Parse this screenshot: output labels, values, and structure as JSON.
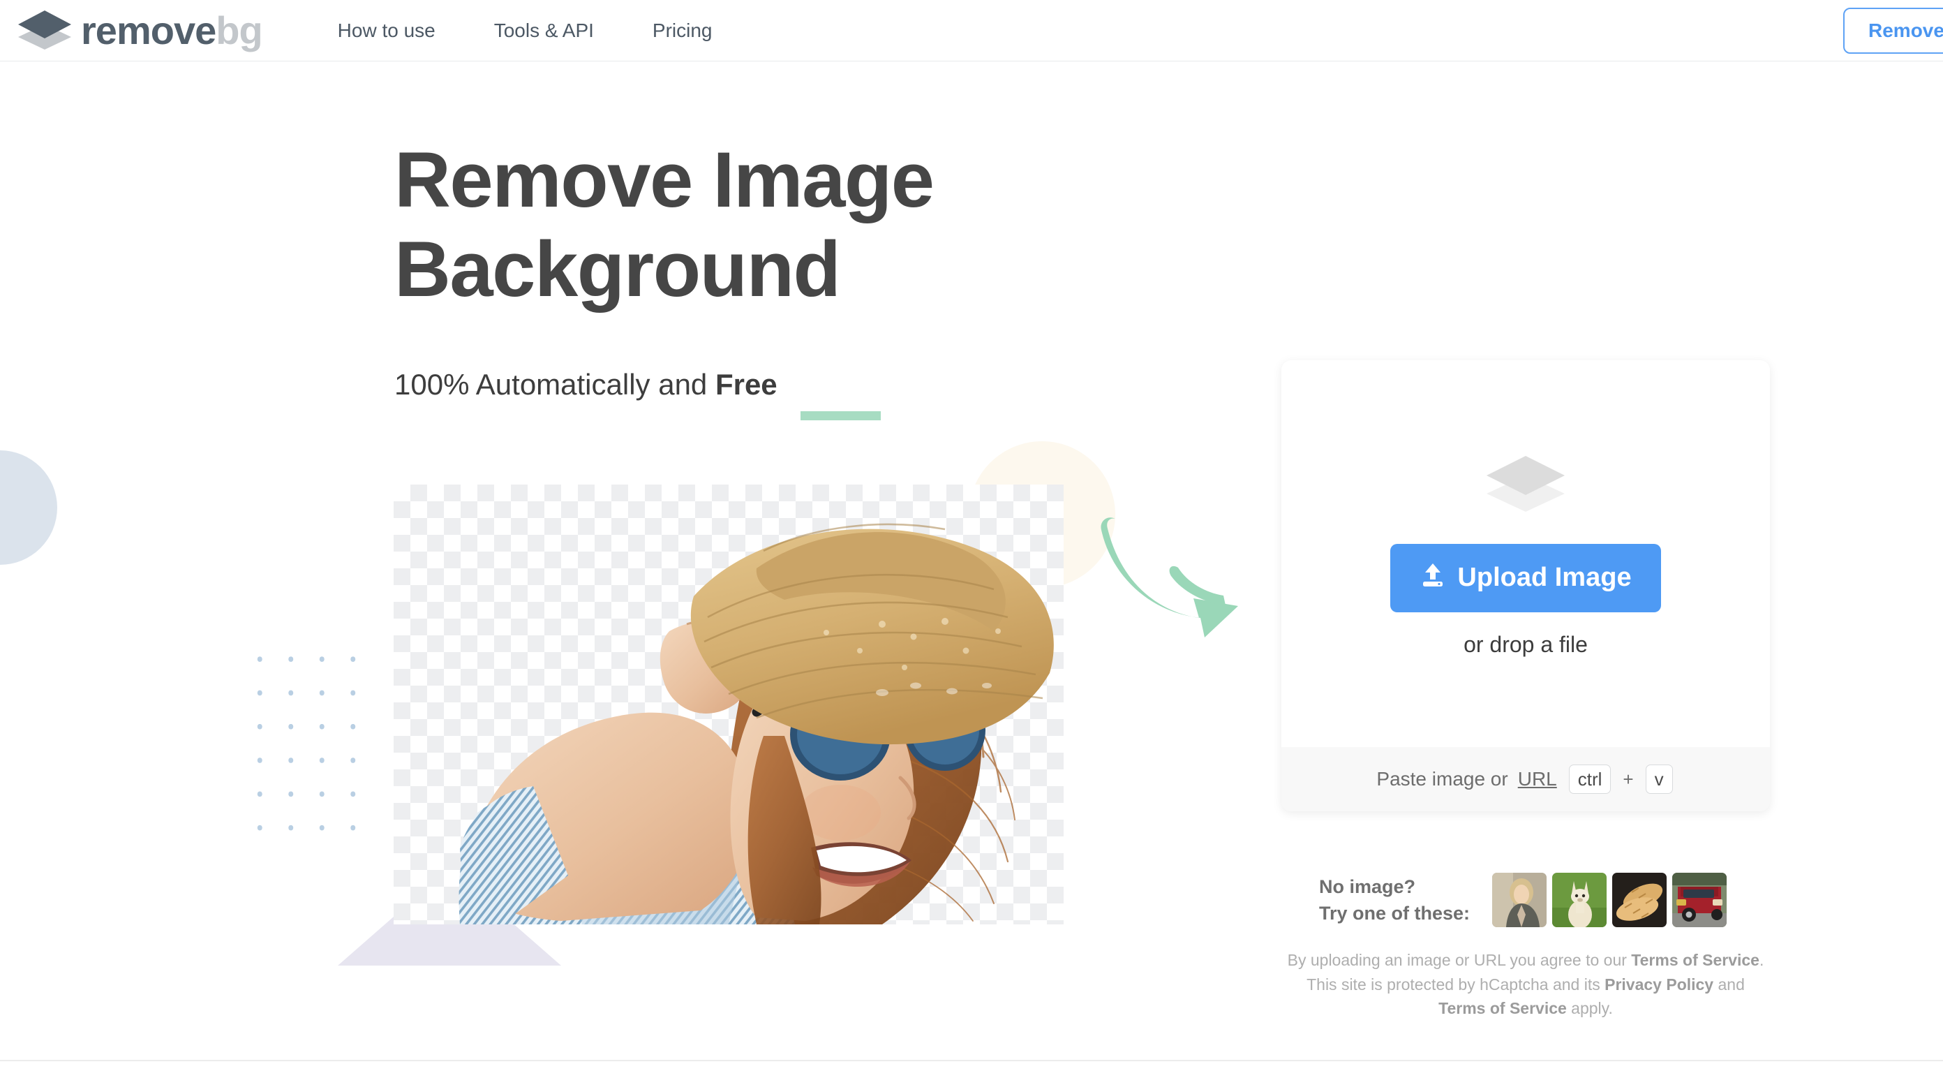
{
  "header": {
    "logo": {
      "icon": "stacked-layers-logo-icon",
      "text_primary": "remove",
      "text_secondary": "bg"
    },
    "nav": [
      {
        "label": "How to use"
      },
      {
        "label": "Tools & API"
      },
      {
        "label": "Pricing"
      }
    ],
    "cta": {
      "label": "Remove Background"
    }
  },
  "hero": {
    "title_line1": "Remove Image",
    "title_line2": "Background",
    "subtitle_prefix": "100% Automatically and ",
    "subtitle_emphasis": "Free",
    "image_alt": "Woman in straw hat and sunglasses with transparent checkerboard background"
  },
  "upload": {
    "stack_icon": "stacked-layers-icon",
    "button_icon": "upload-arrow-icon",
    "button_label": "Upload Image",
    "drop_text": "or drop a file",
    "paste_text": "Paste image or ",
    "paste_link": "URL",
    "key_ctrl": "ctrl",
    "key_plus": "+",
    "key_v": "v"
  },
  "samples": {
    "label_line1": "No image?",
    "label_line2": "Try one of these:",
    "items": [
      {
        "name": "sample-woman",
        "alt": "Blonde woman in grey cardigan"
      },
      {
        "name": "sample-alpaca",
        "alt": "White alpaca on green grass"
      },
      {
        "name": "sample-bread",
        "alt": "Two loaves of bread"
      },
      {
        "name": "sample-car",
        "alt": "Red SUV rear view"
      }
    ]
  },
  "legal": {
    "part1": "By uploading an image or URL you agree to our ",
    "tos1": "Terms of Service",
    "part2": ". This site is protected by hCaptcha and its ",
    "privacy": "Privacy Policy",
    "part3": " and ",
    "tos2": "Terms of Service",
    "part4": " apply."
  },
  "colors": {
    "accent_blue": "#4e9af4",
    "cta_border": "#5ea2f5",
    "logo_dark": "#525f6b",
    "logo_light": "#c3c7cb",
    "arrow_green": "#9ad7b8",
    "underline_green": "#a7dcc2",
    "checker_gray": "#edeef0",
    "decor_blue": "#dbe3ec",
    "decor_cream": "#fdf8ee",
    "decor_lavender": "#e7e5f0",
    "decor_dot_blue": "#b9cfe3",
    "heading_gray": "#464646"
  }
}
